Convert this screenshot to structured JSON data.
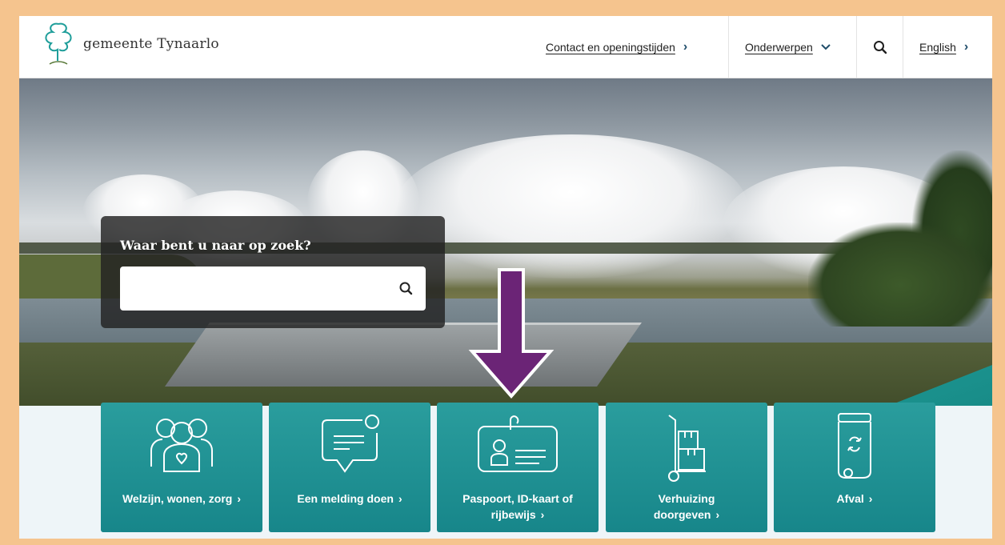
{
  "header": {
    "logo_text": "gemeente Tynaarlo",
    "nav": {
      "contact": "Contact en openingstijden",
      "topics": "Onderwerpen",
      "language": "English"
    },
    "icons": {
      "search": "search-icon",
      "chevron_right": "›",
      "chevron_down": "⌄"
    }
  },
  "search": {
    "title": "Waar bent u naar op zoek?",
    "value": "",
    "placeholder": ""
  },
  "tiles": [
    {
      "label_1": "Welzijn, wonen, zorg",
      "label_2": "",
      "icon": "people-heart-icon"
    },
    {
      "label_1": "Een melding doen",
      "label_2": "",
      "icon": "speech-bubble-icon"
    },
    {
      "label_1": "Paspoort, ID-kaart of",
      "label_2": "rijbewijs",
      "icon": "id-card-icon"
    },
    {
      "label_1": "Verhuizing",
      "label_2": "doorgeven",
      "icon": "moving-trolley-icon"
    },
    {
      "label_1": "Afval",
      "label_2": "",
      "icon": "recycle-bin-icon"
    }
  ],
  "colors": {
    "frame": "#f5c48e",
    "tile": "#1a8c8e",
    "annotation_arrow": "#6b2476"
  }
}
